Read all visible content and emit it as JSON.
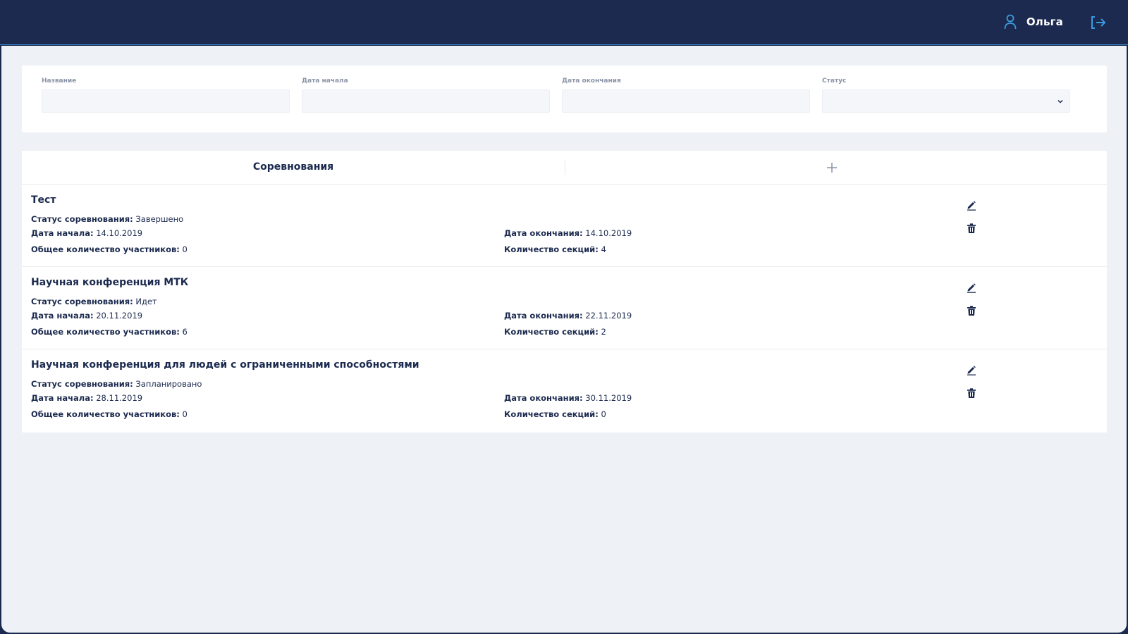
{
  "header": {
    "user_name": "Ольга",
    "user_icon": "user-icon",
    "logout_icon": "logout-icon",
    "accent": "#3a9be0",
    "bg": "#1b2a4e"
  },
  "filters": {
    "name_label": "Название",
    "name_value": "",
    "start_label": "Дата начала",
    "start_value": "",
    "end_label": "Дата окончания",
    "end_value": "",
    "status_label": "Статус",
    "status_value": ""
  },
  "list": {
    "title": "Соревнования",
    "add_icon": "plus-icon",
    "labels": {
      "status": "Статус соревнования:",
      "start": "Дата начала:",
      "end": "Дата окончания:",
      "participants": "Общее количество участников:",
      "sections": "Количество секций:"
    },
    "items": [
      {
        "title": "Тест",
        "status": "Завершено",
        "start": "14.10.2019",
        "end": "14.10.2019",
        "participants": "0",
        "sections": "4"
      },
      {
        "title": "Научная конференция МТК",
        "status": "Идет",
        "start": "20.11.2019",
        "end": "22.11.2019",
        "participants": "6",
        "sections": "2"
      },
      {
        "title": "Научная конференция для людей с ограниченными способностями",
        "status": "Запланировано",
        "start": "28.11.2019",
        "end": "30.11.2019",
        "participants": "0",
        "sections": "0"
      }
    ]
  }
}
